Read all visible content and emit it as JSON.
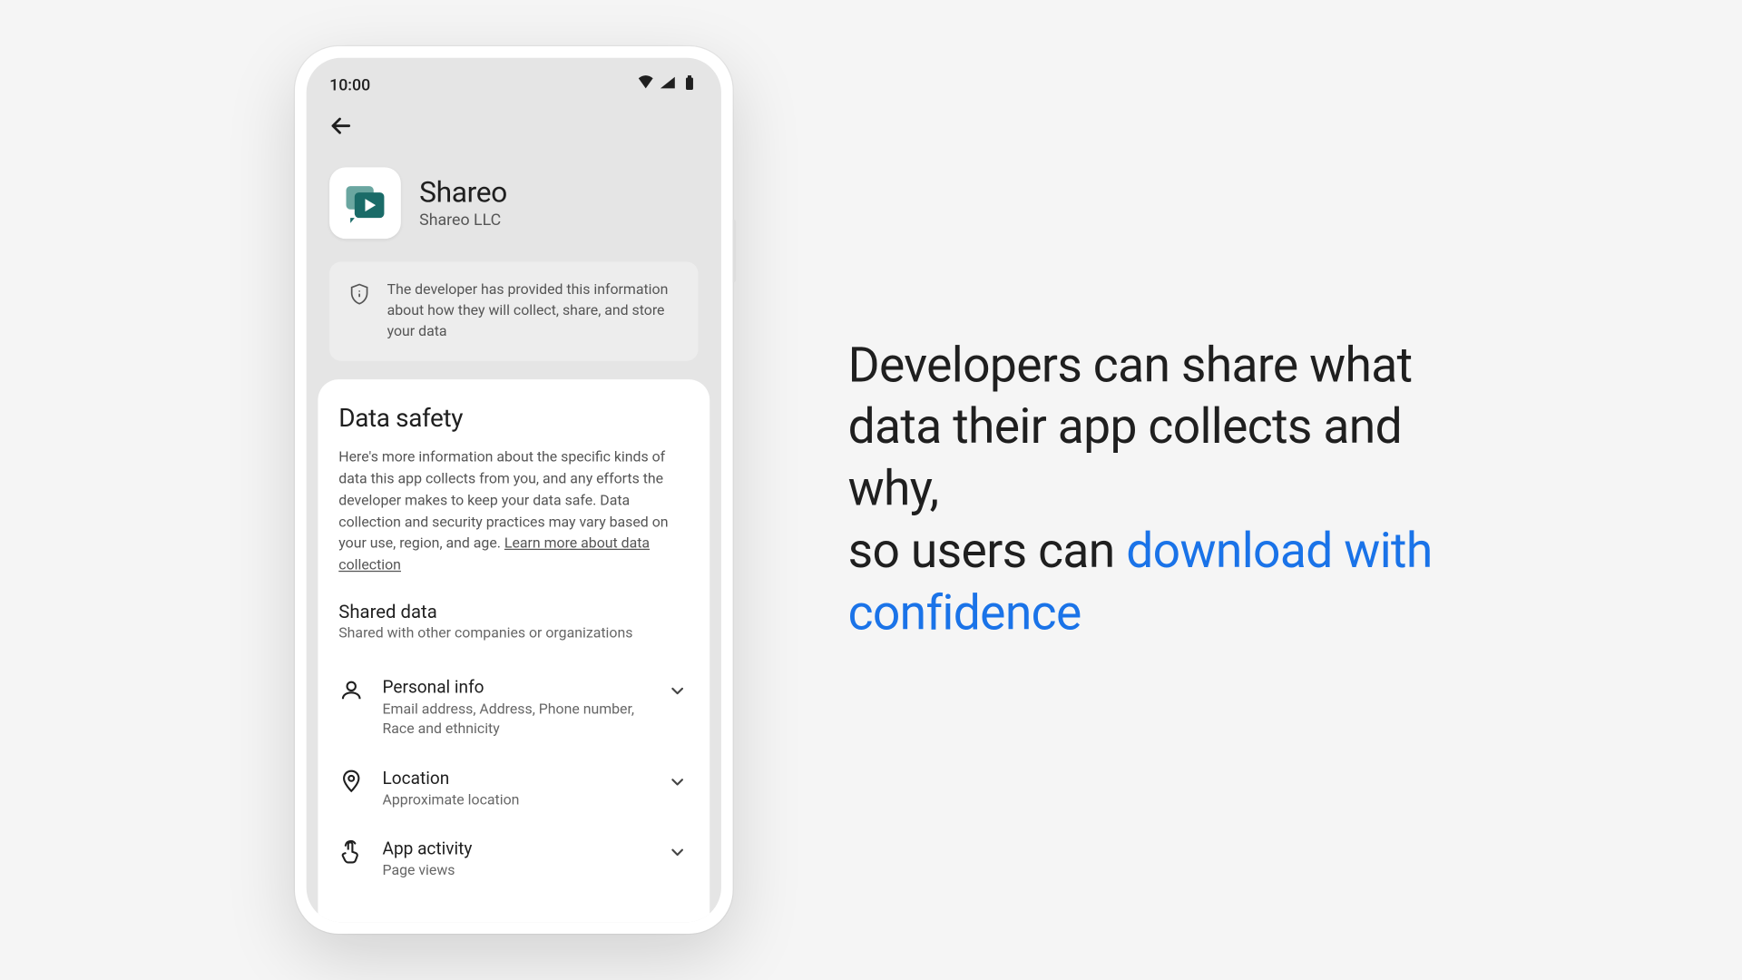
{
  "status": {
    "time": "10:00"
  },
  "app": {
    "name": "Shareo",
    "developer": "Shareo LLC"
  },
  "banner": {
    "text": "The developer has provided this information about how they will collect, share, and store your data"
  },
  "safety": {
    "heading": "Data safety",
    "desc": "Here's more information about the specific kinds of data this app collects from you, and any efforts the developer makes to keep your data safe. Data collection and security practices may vary based on your use, region, and age. ",
    "link": "Learn more about data collection"
  },
  "shared": {
    "title": "Shared data",
    "sub": "Shared with other companies or organizations",
    "rows": [
      {
        "title": "Personal info",
        "sub": "Email address, Address, Phone number, Race and ethnicity"
      },
      {
        "title": "Location",
        "sub": "Approximate location"
      },
      {
        "title": "App activity",
        "sub": "Page views"
      }
    ]
  },
  "headline": {
    "part1": "Developers can share what data their app collects and why,",
    "part2": "so users can ",
    "accent": "download with confidence"
  }
}
